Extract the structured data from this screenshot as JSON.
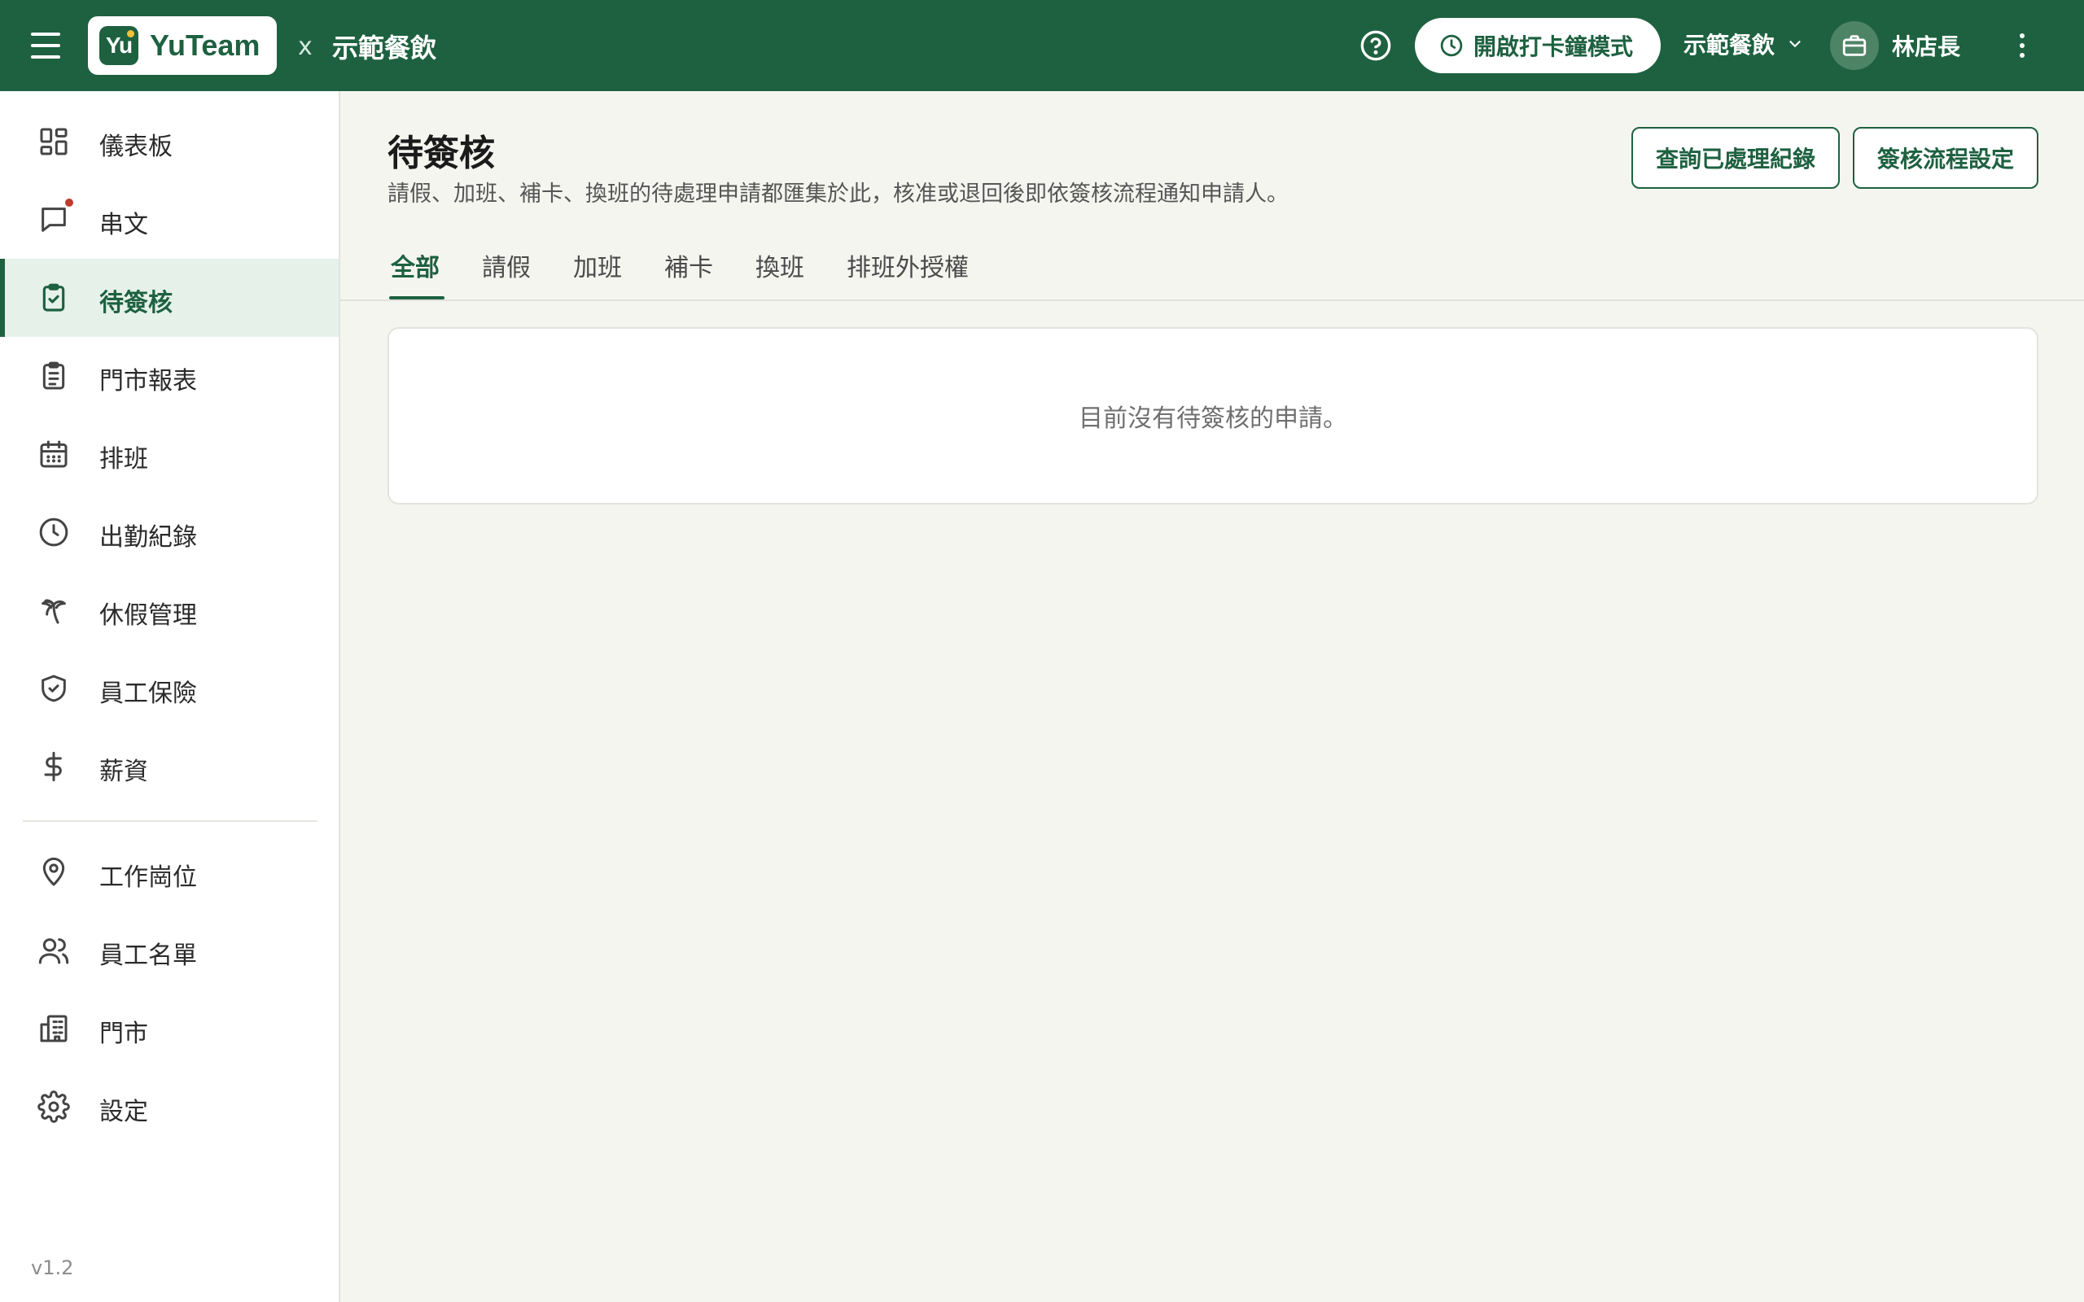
{
  "header": {
    "brand": "YuTeam",
    "logo_mark": "Yu",
    "separator": "x",
    "company": "示範餐飲",
    "clock_mode_label": "開啟打卡鐘模式",
    "store_select": "示範餐飲",
    "user_name": "林店長"
  },
  "sidebar": {
    "items": [
      {
        "label": "儀表板",
        "icon": "dashboard-icon"
      },
      {
        "label": "串文",
        "icon": "chat-icon"
      },
      {
        "label": "待簽核",
        "icon": "clipboard-check-icon"
      },
      {
        "label": "門市報表",
        "icon": "clipboard-list-icon"
      },
      {
        "label": "排班",
        "icon": "calendar-icon"
      },
      {
        "label": "出勤紀錄",
        "icon": "clock-icon"
      },
      {
        "label": "休假管理",
        "icon": "palm-tree-icon"
      },
      {
        "label": "員工保險",
        "icon": "shield-check-icon"
      },
      {
        "label": "薪資",
        "icon": "dollar-icon"
      },
      {
        "label": "工作崗位",
        "icon": "map-pin-icon"
      },
      {
        "label": "員工名單",
        "icon": "users-icon"
      },
      {
        "label": "門市",
        "icon": "building-icon"
      },
      {
        "label": "設定",
        "icon": "gear-icon"
      }
    ],
    "active": "待簽核",
    "version": "v1.2"
  },
  "main": {
    "title": "待簽核",
    "description": "請假、加班、補卡、換班的待處理申請都匯集於此，核准或退回後即依簽核流程通知申請人。",
    "history_button": "查詢已處理紀錄",
    "flow_button": "簽核流程設定",
    "tabs": [
      "全部",
      "請假",
      "加班",
      "補卡",
      "換班",
      "排班外授權"
    ],
    "active_tab": "全部",
    "empty_message": "目前沒有待簽核的申請。"
  },
  "colors": {
    "brand_green": "#1e6140",
    "active_bg": "#e6f1ea",
    "notification_dot": "#c0392b"
  }
}
